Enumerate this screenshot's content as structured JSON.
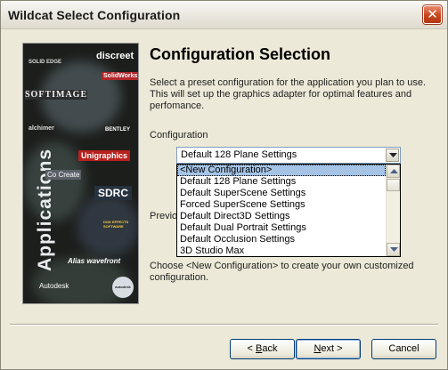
{
  "window": {
    "title": "Wildcat Select Configuration",
    "close_symbol": "✕"
  },
  "side_image": {
    "vertical_text": "Applications",
    "logos": [
      "SOLID EDGE",
      "discreet",
      "SolidWorks",
      "SOFTIMAGE",
      "alchimer",
      "BENTLEY",
      "Unigraphics",
      "Co Create",
      "SDRC",
      "DOK EFFECTS SOFTWARE",
      "Alias wavefront",
      "Autodesk",
      "autodesk"
    ]
  },
  "main": {
    "heading": "Configuration Selection",
    "intro": "Select a preset configuration for the application you plan to use. This will set up the graphics adapter for optimal features and perfomance.",
    "config_label": "Configuration",
    "selected_value": "Default 128 Plane Settings",
    "options": [
      "<New Configuration>",
      "Default 128 Plane Settings",
      "Default SuperScene Settings",
      "Forced SuperScene Settings",
      "Default Direct3D Settings",
      "Default Dual Portrait Settings",
      "Default Occlusion Settings",
      "3D Studio Max"
    ],
    "highlighted_option_index": 0,
    "previous_text": "Previo choos",
    "hint": "Choose <New Configuration> to create your own customized configuration."
  },
  "buttons": {
    "back": {
      "pre": "< ",
      "accel": "B",
      "post": "ack"
    },
    "next": {
      "pre": "",
      "accel": "N",
      "post": "ext >"
    },
    "cancel": "Cancel"
  },
  "colors": {
    "selection": "#a5c4e5",
    "close_button": "#c8461e",
    "dialog_bg": "#ECE9D8"
  }
}
